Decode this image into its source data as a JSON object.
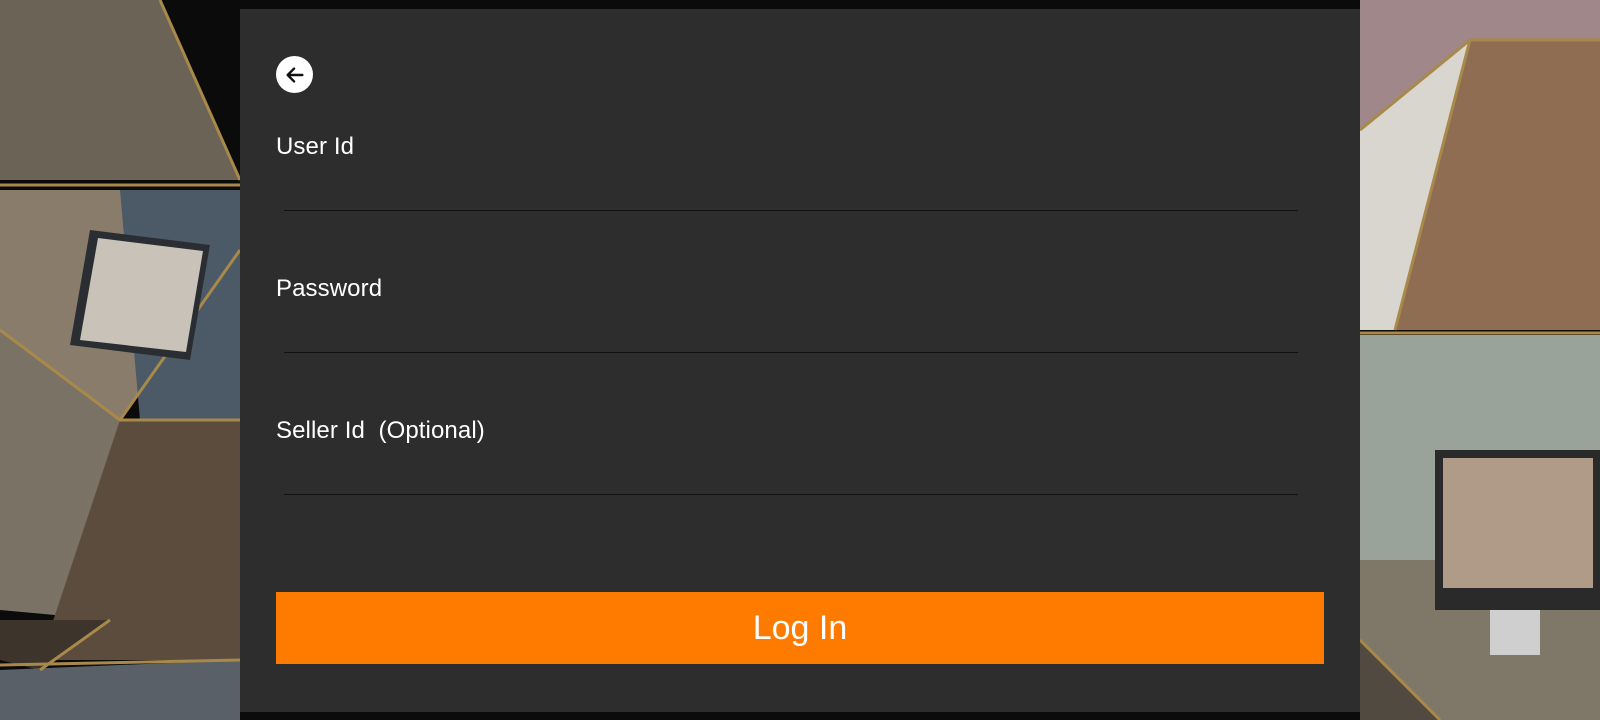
{
  "colors": {
    "panel_bg": "#2c2d2c",
    "accent": "#ff7b00",
    "text": "#ffffff",
    "background": "#0b0b0b",
    "collage_border": "#a8894a"
  },
  "form": {
    "back_icon": "arrow-left-icon",
    "fields": [
      {
        "label": "User Id",
        "value": "",
        "placeholder": ""
      },
      {
        "label": "Password",
        "value": "",
        "placeholder": ""
      },
      {
        "label": "Seller Id  (Optional)",
        "value": "",
        "placeholder": ""
      }
    ],
    "submit_label": "Log In"
  }
}
